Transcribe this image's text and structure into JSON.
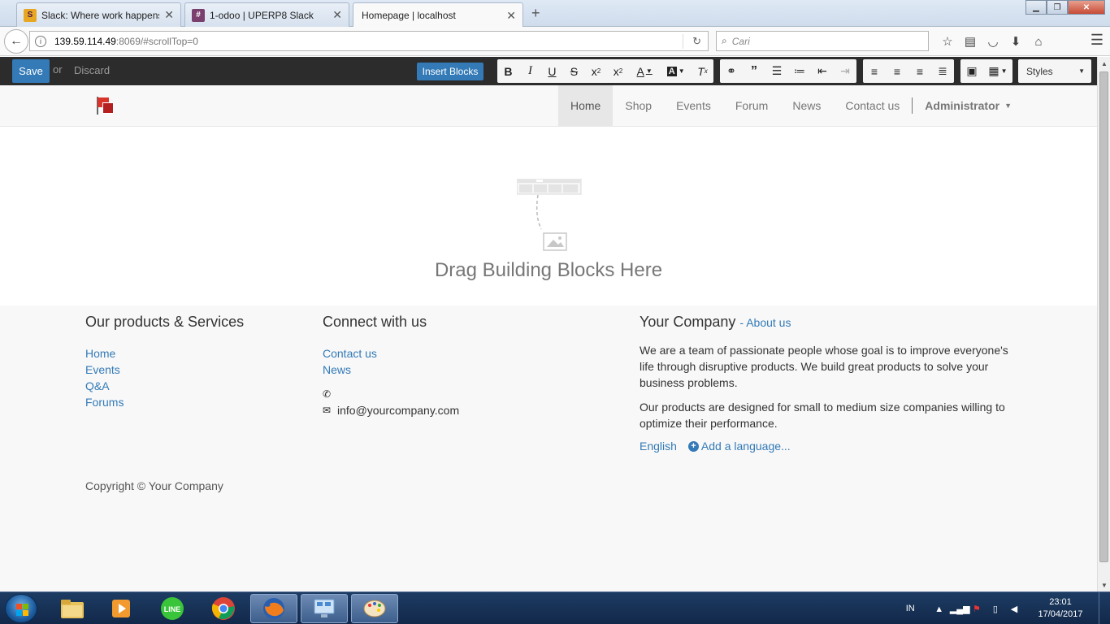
{
  "browser": {
    "tabs": [
      {
        "title": "Slack: Where work happens",
        "favicon": "S",
        "favicon_color": "#e8a722",
        "active": false
      },
      {
        "title": "1-odoo | UPERP8 Slack",
        "favicon": "#",
        "favicon_color": "#7b3f6e",
        "active": false
      },
      {
        "title": "Homepage | localhost",
        "favicon": "",
        "favicon_color": "",
        "active": true
      }
    ],
    "new_tab": "+",
    "url_host": "139.59.114.49",
    "url_path": ":8069/#scrollTop=0",
    "search_placeholder": "Cari"
  },
  "editor": {
    "save_label": "Save",
    "or_label": "or",
    "discard_label": "Discard",
    "insert_blocks_label": "Insert Blocks",
    "styles_label": "Styles"
  },
  "site": {
    "nav": [
      "Home",
      "Shop",
      "Events",
      "Forum",
      "News",
      "Contact us"
    ],
    "user": "Administrator"
  },
  "dropzone": {
    "title": "Drag Building Blocks Here"
  },
  "footer": {
    "products_title": "Our products & Services",
    "products_links": [
      "Home",
      "Events",
      "Q&A",
      "Forums"
    ],
    "connect_title": "Connect with us",
    "connect_links": [
      "Contact us",
      "News"
    ],
    "email": "info@yourcompany.com",
    "company_title": "Your Company",
    "about_link": "- About us",
    "company_p1": "We are a team of passionate people whose goal is to improve everyone's life through disruptive products. We build great products to solve your business problems.",
    "company_p2": "Our products are designed for small to medium size companies willing to optimize their performance.",
    "lang_current": "English",
    "lang_add": "Add a language...",
    "copyright": "Copyright © Your Company"
  },
  "taskbar": {
    "lang": "IN",
    "time": "23:01",
    "date": "17/04/2017"
  },
  "colors": {
    "accent": "#337ab7",
    "toolbar_bg": "#2c2c2c"
  }
}
